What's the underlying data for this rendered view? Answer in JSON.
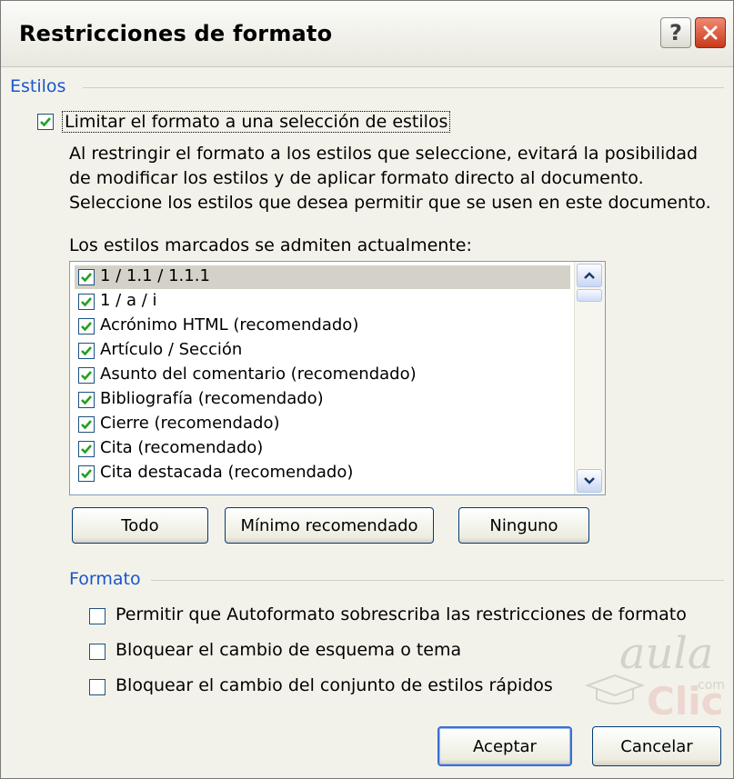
{
  "window": {
    "title": "Restricciones de formato",
    "help_glyph": "?",
    "close_glyph": "✕"
  },
  "estilos": {
    "group_label": "Estilos",
    "limit_checkbox_label": "Limitar el formato a una selección de estilos",
    "limit_checked": true,
    "description": "Al restringir el formato a los estilos que seleccione, evitará la posibilidad de modificar los estilos y de aplicar formato directo al documento. Seleccione los estilos que desea permitir que se usen en este documento.",
    "list_label": "Los estilos marcados se admiten actualmente:",
    "items": [
      {
        "label": "1 / 1.1 / 1.1.1",
        "checked": true,
        "selected": true
      },
      {
        "label": "1 / a / i",
        "checked": true,
        "selected": false
      },
      {
        "label": "Acrónimo HTML (recomendado)",
        "checked": true,
        "selected": false
      },
      {
        "label": "Artículo / Sección",
        "checked": true,
        "selected": false
      },
      {
        "label": "Asunto del comentario (recomendado)",
        "checked": true,
        "selected": false
      },
      {
        "label": "Bibliografía (recomendado)",
        "checked": true,
        "selected": false
      },
      {
        "label": "Cierre (recomendado)",
        "checked": true,
        "selected": false
      },
      {
        "label": "Cita (recomendado)",
        "checked": true,
        "selected": false
      },
      {
        "label": "Cita destacada (recomendado)",
        "checked": true,
        "selected": false
      }
    ],
    "buttons": {
      "todo": "Todo",
      "minimo": "Mínimo recomendado",
      "ninguno": "Ninguno"
    }
  },
  "formato": {
    "group_label": "Formato",
    "options": [
      {
        "label": "Permitir que Autoformato sobrescriba las restricciones de formato",
        "checked": false
      },
      {
        "label": "Bloquear el cambio de esquema o tema",
        "checked": false
      },
      {
        "label": "Bloquear el cambio del conjunto de estilos rápidos",
        "checked": false
      }
    ]
  },
  "footer": {
    "ok": "Aceptar",
    "cancel": "Cancelar"
  },
  "watermark": {
    "line1": "aula",
    "line2": "Clic",
    "line3": "com"
  },
  "colors": {
    "group_label": "#1a56cc",
    "check": "#21a121",
    "close_button": "#c9381b"
  }
}
